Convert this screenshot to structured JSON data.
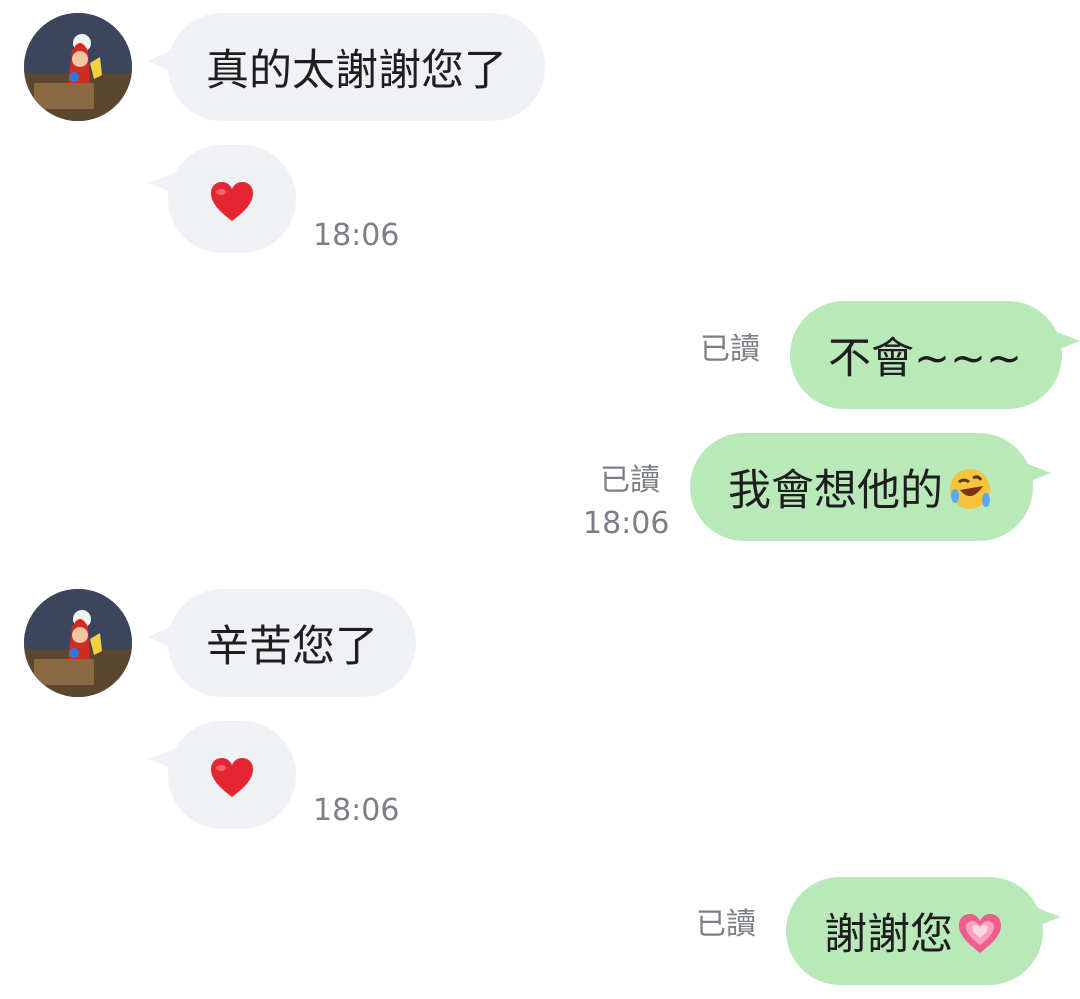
{
  "messages": [
    {
      "side": "incoming",
      "text": "真的太謝謝您了"
    },
    {
      "side": "incoming",
      "reaction": "heart",
      "time": "18:06"
    },
    {
      "side": "outgoing",
      "text": "不會~~~",
      "read_label": "已讀"
    },
    {
      "side": "outgoing",
      "text": "我會想他的",
      "emoji": "rolling-on-floor-laughing",
      "read_label": "已讀",
      "time": "18:06"
    },
    {
      "side": "incoming",
      "text": "辛苦您了"
    },
    {
      "side": "incoming",
      "reaction": "heart",
      "time": "18:06"
    },
    {
      "side": "outgoing",
      "text": "謝謝您",
      "emoji": "growing-heart",
      "read_label": "已讀"
    }
  ],
  "colors": {
    "incoming_bubble": "#f0f1f4",
    "outgoing_bubble": "#b9e9b9",
    "meta_text": "#7c7f86",
    "message_text": "#1e1e1e",
    "heart": "#e3262f"
  }
}
